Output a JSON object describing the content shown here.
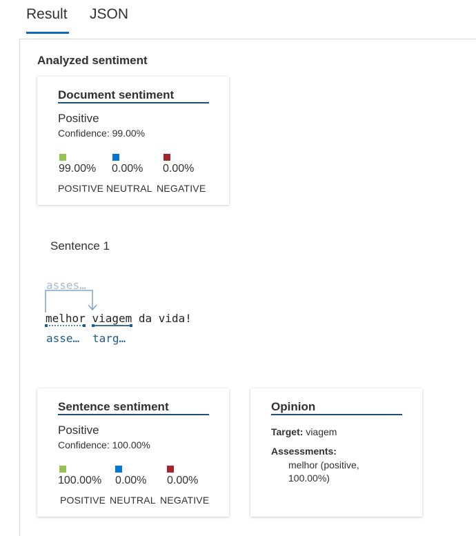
{
  "tabs": {
    "result": "Result",
    "json": "JSON"
  },
  "section_title": "Analyzed sentiment",
  "document_card": {
    "title": "Document sentiment",
    "label": "Positive",
    "confidence": "Confidence: 99.00%",
    "scores": [
      {
        "value": "99.00%",
        "caption": "POSITIVE",
        "color": "#92c353"
      },
      {
        "value": "0.00%",
        "caption": "NEUTRAL",
        "color": "#0078d4"
      },
      {
        "value": "0.00%",
        "caption": "NEGATIVE",
        "color": "#a4262c"
      }
    ]
  },
  "sentence": {
    "heading": "Sentence 1",
    "relation_label": "asses…",
    "text_words": [
      "melhor",
      "viagem",
      "da vida!"
    ],
    "tags": {
      "assessment": "asse…",
      "target": "targ…"
    }
  },
  "sentence_card": {
    "title": "Sentence sentiment",
    "label": "Positive",
    "confidence": "Confidence: 100.00%",
    "scores": [
      {
        "value": "100.00%",
        "caption": "POSITIVE",
        "color": "#92c353"
      },
      {
        "value": "0.00%",
        "caption": "NEUTRAL",
        "color": "#0078d4"
      },
      {
        "value": "0.00%",
        "caption": "NEGATIVE",
        "color": "#a4262c"
      }
    ]
  },
  "opinion_card": {
    "title": "Opinion",
    "target_key": "Target:",
    "target_value": "viagem",
    "assessments_key": "Assessments:",
    "assessment_line1": "melhor (positive,",
    "assessment_line2": "100.00%)"
  },
  "colors": {
    "accent": "#0f6cbd",
    "rule": "#1f4e79",
    "tag": "#1f5c8e"
  }
}
